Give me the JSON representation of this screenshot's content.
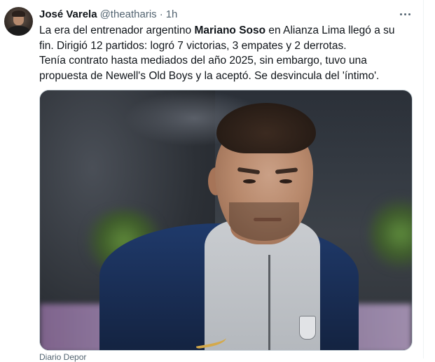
{
  "tweet": {
    "author_name": "José Varela",
    "author_handle": "@theatharis",
    "separator": "·",
    "time": "1h",
    "more_label": "More",
    "text_lines": [
      {
        "pre": "La era del entrenador argentino ",
        "bold": "Mariano Soso",
        "post": " en Alianza Lima llegó a su"
      },
      {
        "pre": "fin. Dirigió 12 partidos: logró 7 victorias, 3 empates y 2 derrotas.",
        "bold": "",
        "post": ""
      },
      {
        "pre": "Tenía contrato hasta mediados del año 2025, sin embargo, tuvo una",
        "bold": "",
        "post": ""
      },
      {
        "pre": "propuesta de Newell's Old Boys y la aceptó. Se desvincula del 'íntimo'.",
        "bold": "",
        "post": ""
      }
    ],
    "media_source": "Diario Depor"
  },
  "icons": {
    "more": "more-horizontal-icon",
    "avatar": "avatar"
  }
}
